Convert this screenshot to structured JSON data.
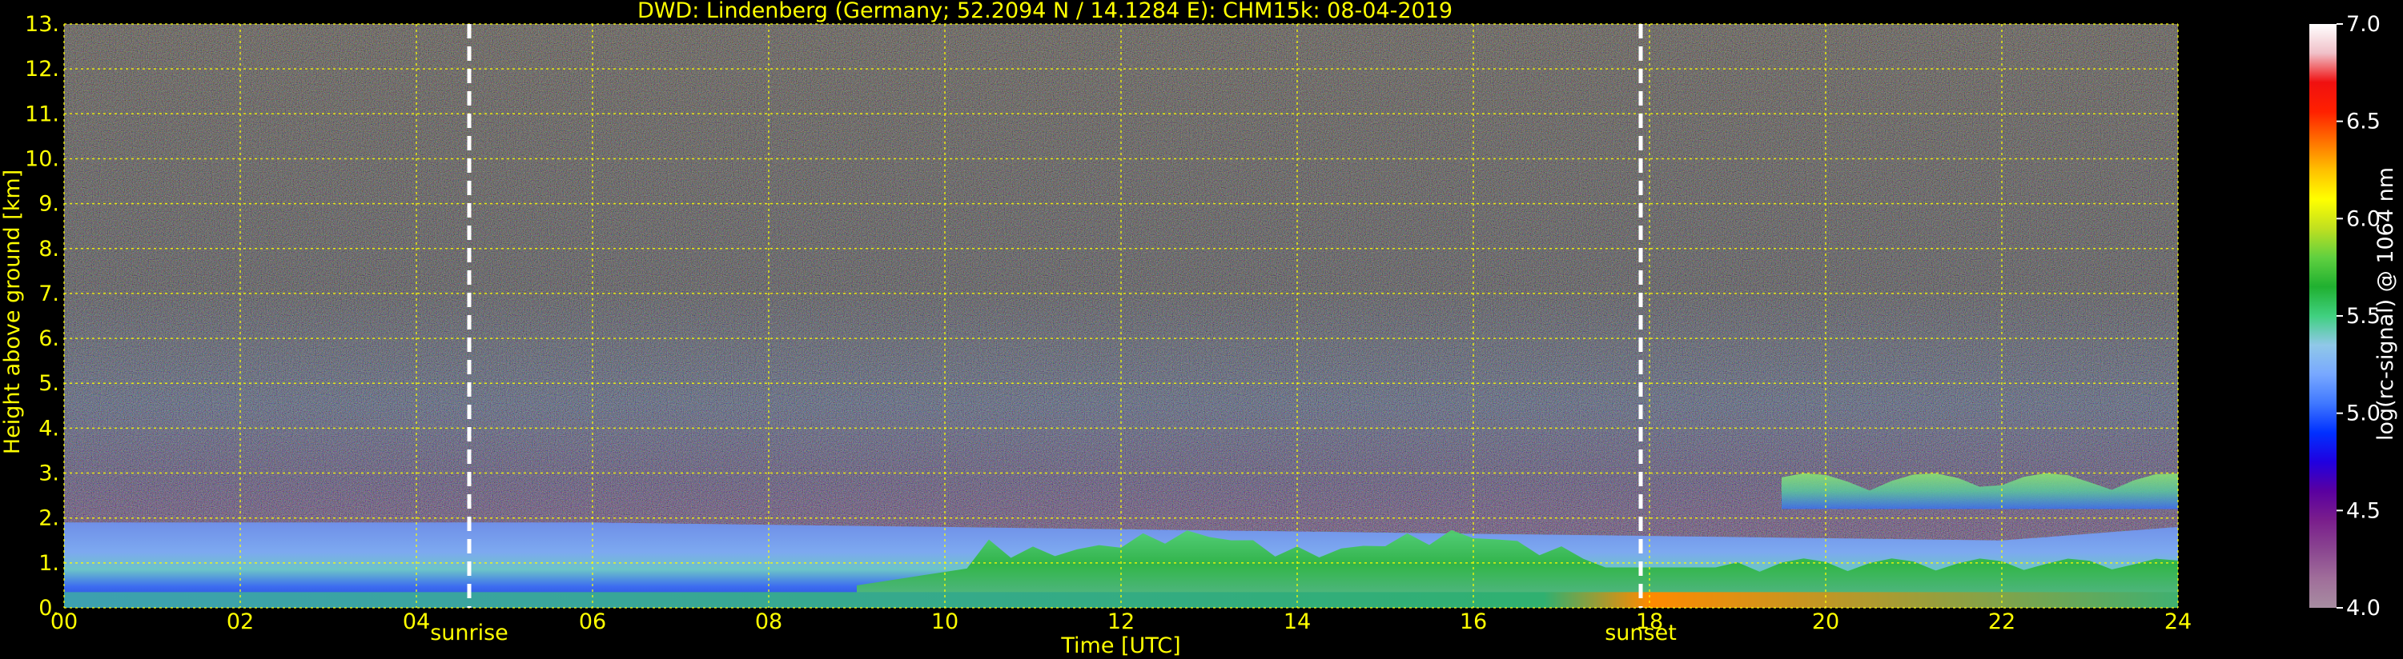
{
  "chart_data": {
    "type": "heatmap",
    "title": "DWD: Lindenberg (Germany; 52.2094 N / 14.1284 E):    CHM15k: 08-04-2019",
    "xlabel": "Time [UTC]",
    "ylabel": "Height above ground [km]",
    "xlim": [
      0,
      24
    ],
    "ylim": [
      0,
      13
    ],
    "x_ticks": [
      0,
      2,
      4,
      6,
      8,
      10,
      12,
      14,
      16,
      18,
      20,
      22,
      24
    ],
    "x_tick_labels": [
      "00",
      "02",
      "04",
      "06",
      "08",
      "10",
      "12",
      "14",
      "16",
      "18",
      "20",
      "22",
      "24"
    ],
    "y_ticks": [
      0,
      1,
      2,
      3,
      4,
      5,
      6,
      7,
      8,
      9,
      10,
      11,
      12,
      13
    ],
    "y_tick_labels": [
      "0.",
      "1.",
      "2.",
      "3.",
      "4.",
      "5.",
      "6.",
      "7.",
      "8.",
      "9.",
      "10.",
      "11.",
      "12.",
      "13."
    ],
    "grid": true,
    "markers": [
      {
        "label": "sunrise",
        "x": 4.6
      },
      {
        "label": "sunset",
        "x": 17.9
      }
    ],
    "colorbar": {
      "label": "log(rc-signal) @ 1064 nm",
      "range": [
        4.0,
        7.0
      ],
      "ticks": [
        4.0,
        4.5,
        5.0,
        5.5,
        6.0,
        6.5,
        7.0
      ],
      "tick_labels": [
        "4.0",
        "4.5",
        "5.0",
        "5.5",
        "6.0",
        "6.5",
        "7.0"
      ],
      "colors": [
        "#a78da1",
        "#a06e9a",
        "#8a4590",
        "#7a1e8c",
        "#5a00a0",
        "#2000e0",
        "#0030ff",
        "#4078ff",
        "#78a8ff",
        "#90c8e8",
        "#40d080",
        "#20b030",
        "#60d040",
        "#c0e020",
        "#ffff00",
        "#ffc000",
        "#ff7000",
        "#ff2000",
        "#f01010",
        "#f0c0c8",
        "#ffffff"
      ]
    },
    "layers": [
      {
        "name": "boundary layer",
        "x_start": 0,
        "x_end": 24,
        "top_km": [
          1.9,
          1.9,
          1.9,
          1.9,
          1.85,
          1.8,
          1.75,
          1.7,
          1.65,
          1.6,
          1.55,
          1.5,
          1.8
        ]
      },
      {
        "name": "clouds",
        "x_start": 19.5,
        "x_end": 24,
        "base_km": 2.2,
        "top_km": 3.0
      }
    ]
  },
  "colors": {
    "axis_text": "#ffff00",
    "colorbar_text": "#ffffff",
    "grid": "#ffff00",
    "marker": "#ffffff"
  }
}
